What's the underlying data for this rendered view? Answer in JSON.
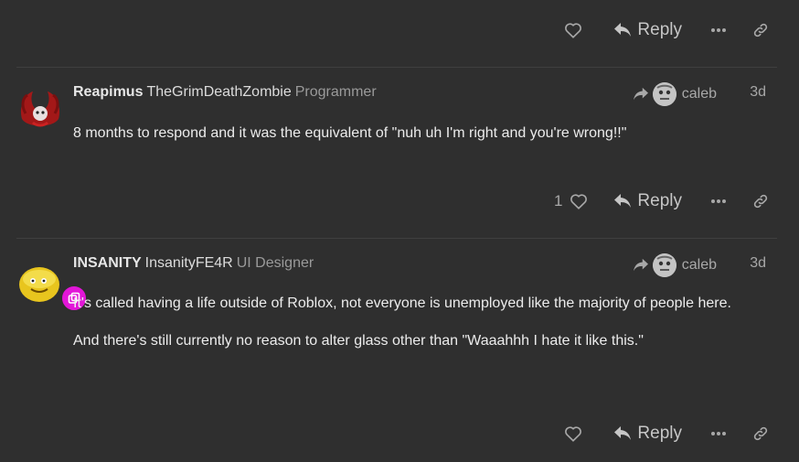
{
  "actions_top": {
    "reply_label": "Reply"
  },
  "posts": [
    {
      "display_name": "Reapimus",
      "username": "TheGrimDeathZombie",
      "user_title": "Programmer",
      "reply_to_user": "caleb",
      "date": "3d",
      "paragraphs": [
        "8 months to respond and it was the equivalent of \"nuh uh I'm right and you're wrong!!\""
      ],
      "like_count": "1",
      "reply_label": "Reply"
    },
    {
      "display_name": "INSANITY",
      "username": "InsanityFE4R",
      "user_title": "UI Designer",
      "reply_to_user": "caleb",
      "date": "3d",
      "paragraphs": [
        "It's called having a life outside of Roblox, not everyone is unemployed like the majority of people here.",
        "And there's still currently no reason to alter glass other than \"Waaahhh I hate it like this.\""
      ],
      "like_count": "",
      "reply_label": "Reply"
    }
  ],
  "colors": {
    "background": "#2f2f2f",
    "badge": "#e216d8"
  },
  "icons": [
    "heart-icon",
    "reply-arrow-icon",
    "ellipsis-icon",
    "link-icon",
    "share-arrow-icon"
  ]
}
